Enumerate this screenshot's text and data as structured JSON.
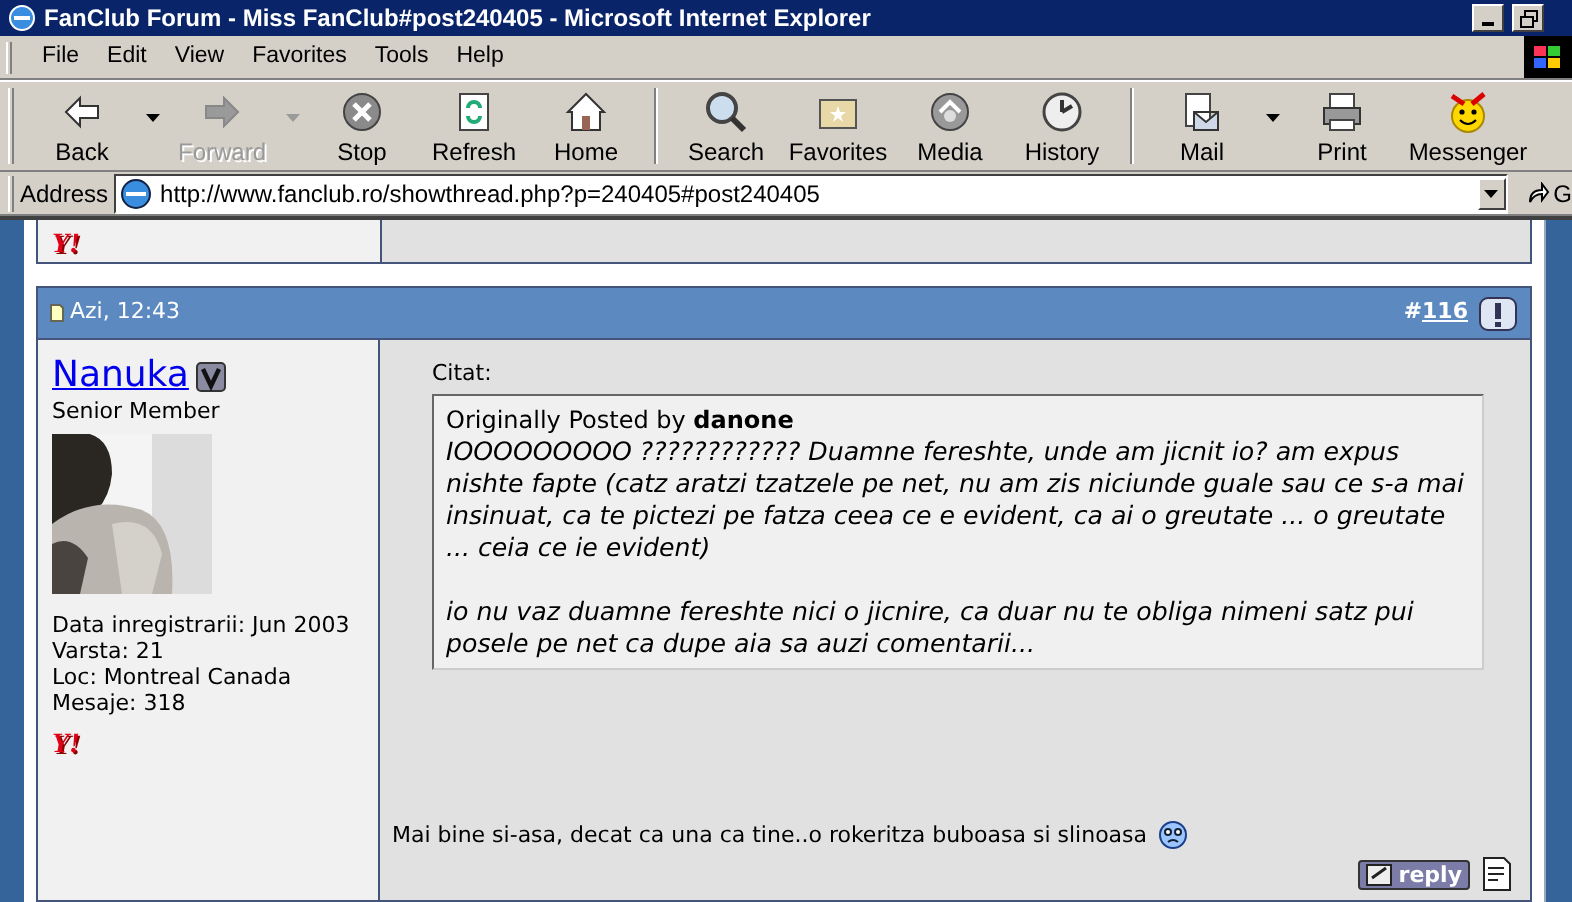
{
  "window": {
    "title": "FanClub Forum - Miss FanClub#post240405 - Microsoft Internet Explorer"
  },
  "menu": [
    "File",
    "Edit",
    "View",
    "Favorites",
    "Tools",
    "Help"
  ],
  "toolbar": [
    {
      "kind": "back",
      "label": "Back",
      "disabled": false,
      "dropdown": true
    },
    {
      "kind": "forward",
      "label": "Forward",
      "disabled": true,
      "dropdown": true
    },
    {
      "kind": "stop",
      "label": "Stop",
      "disabled": false,
      "dropdown": false
    },
    {
      "kind": "refresh",
      "label": "Refresh",
      "disabled": false,
      "dropdown": false
    },
    {
      "kind": "home",
      "label": "Home",
      "disabled": false,
      "dropdown": false
    },
    {
      "kind": "search",
      "label": "Search",
      "disabled": false,
      "dropdown": false
    },
    {
      "kind": "favorites",
      "label": "Favorites",
      "disabled": false,
      "dropdown": false
    },
    {
      "kind": "media",
      "label": "Media",
      "disabled": false,
      "dropdown": false
    },
    {
      "kind": "history",
      "label": "History",
      "disabled": false,
      "dropdown": false
    },
    {
      "kind": "mail",
      "label": "Mail",
      "disabled": false,
      "dropdown": true
    },
    {
      "kind": "print",
      "label": "Print",
      "disabled": false,
      "dropdown": false
    },
    {
      "kind": "messenger",
      "label": "Messenger",
      "disabled": false,
      "dropdown": false
    }
  ],
  "address_bar": {
    "label": "Address",
    "value": "http://www.fanclub.ro/showthread.php?p=240405#post240405",
    "go": "G"
  },
  "previous_post": {
    "im_icon": "Y!"
  },
  "post": {
    "date": "Azi, 12:43",
    "number_prefix": "#",
    "number": "116",
    "author": {
      "name": "Nanuka",
      "title": "Senior Member",
      "details": [
        "Data inregistrarii: Jun 2003",
        "Varsta: 21",
        "Loc: Montreal Canada",
        "Mesaje: 318"
      ],
      "im_icon": "Y!"
    },
    "quote": {
      "label": "Citat:",
      "by_prefix": "Originally Posted by",
      "by": "danone",
      "paragraphs": [
        "IOOOOOOOOO ???????????? Duamne fereshte, unde am jicnit io? am expus nishte fapte (catz aratzi tzatzele pe net, nu am zis niciunde guale sau ce s-a mai insinuat, ca te pictezi pe fatza ceea ce e evident, ca ai o greutate ... o greutate ... ceia ce ie evident)",
        "io nu vaz duamne fereshte nici o jicnire, ca duar nu te obliga nimeni satz pui posele pe net ca dupe aia sa auzi comentarii..."
      ]
    },
    "message": "Mai bine si-asa, decat ca una ca tine..o rokeritza buboasa si slinoasa",
    "reply_button": "reply"
  }
}
